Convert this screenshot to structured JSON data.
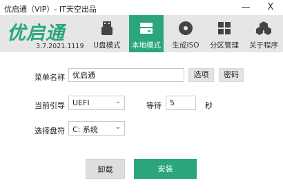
{
  "window": {
    "title": "优启通（VIP）- IT天空出品",
    "minimize": "—",
    "close": "X"
  },
  "logo": {
    "text": "优启通",
    "version": "3.7.2021.1119"
  },
  "tabs": [
    {
      "label": "U盘模式",
      "icon": "usb-icon",
      "active": false
    },
    {
      "label": "本地模式",
      "icon": "drive-icon",
      "active": true
    },
    {
      "label": "生成ISO",
      "icon": "disc-icon",
      "active": false
    },
    {
      "label": "分区管理",
      "icon": "partition-icon",
      "active": false
    },
    {
      "label": "关于程序",
      "icon": "about-icon",
      "active": false
    }
  ],
  "form": {
    "menu_name_label": "菜单名称",
    "menu_name_value": "优启通",
    "options_button": "选项",
    "password_button": "密码",
    "boot_label": "当前引导",
    "boot_value": "UEFI",
    "wait_label": "等待",
    "wait_value": "5",
    "wait_unit": "秒",
    "disk_label": "选择盘符",
    "disk_value": "C: 系统"
  },
  "actions": {
    "uninstall": "卸载",
    "install": "安装"
  },
  "colors": {
    "accent": "#2aa67a",
    "header_bg": "#e6e7e5"
  }
}
